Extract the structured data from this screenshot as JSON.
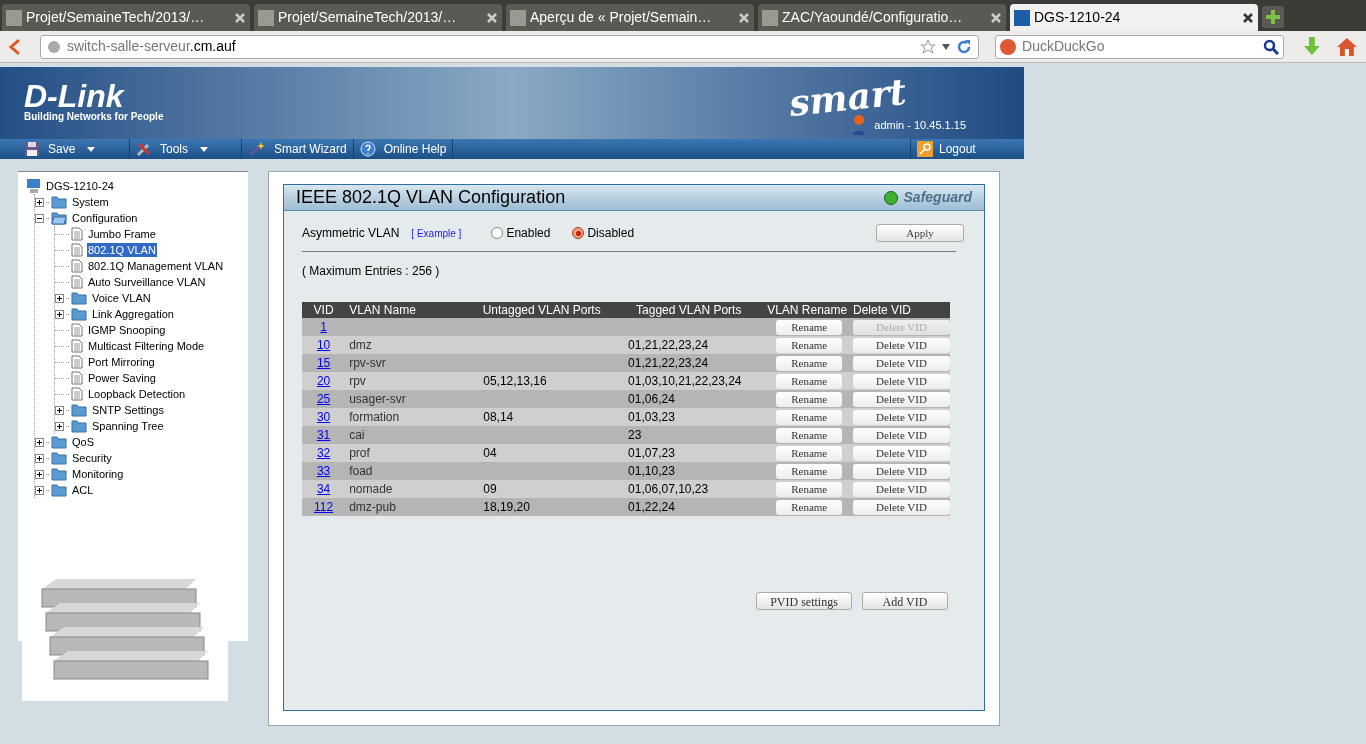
{
  "browser": {
    "tabs": [
      {
        "title": "Projet/SemaineTech/2013/…",
        "selected": false
      },
      {
        "title": "Projet/SemaineTech/2013/…",
        "selected": false
      },
      {
        "title": "Aperçu de « Projet/Semain…",
        "selected": false
      },
      {
        "title": "ZAC/Yaoundé/Configuratio…",
        "selected": false
      },
      {
        "title": "DGS-1210-24",
        "selected": true
      }
    ],
    "address": {
      "host": "switch-salle-serveur",
      "domain": ".cm.auf"
    },
    "search": {
      "placeholder": "DuckDuckGo"
    }
  },
  "header": {
    "brand": "D-Link",
    "tagline": "Building Networks for People",
    "product": "smart",
    "user": "admin - 10.45.1.15"
  },
  "menu": [
    {
      "label": "Save",
      "kind": "save",
      "dropdown": true
    },
    {
      "label": "Tools",
      "kind": "tools",
      "dropdown": true
    },
    {
      "label": "Smart Wizard",
      "kind": "wizard",
      "dropdown": false
    },
    {
      "label": "Online Help",
      "kind": "help",
      "dropdown": false
    }
  ],
  "logout": "Logout",
  "tree": {
    "root": "DGS-1210-24",
    "children": [
      {
        "label": "System",
        "kind": "folder",
        "expanded": false
      },
      {
        "label": "Configuration",
        "kind": "folder",
        "expanded": true,
        "children": [
          {
            "label": "Jumbo Frame",
            "kind": "page",
            "selected": false
          },
          {
            "label": "802.1Q VLAN",
            "kind": "page",
            "selected": true
          },
          {
            "label": "802.1Q Management VLAN",
            "kind": "page",
            "selected": false
          },
          {
            "label": "Auto Surveillance VLAN",
            "kind": "page",
            "selected": false
          },
          {
            "label": "Voice VLAN",
            "kind": "folder",
            "expanded": false
          },
          {
            "label": "Link Aggregation",
            "kind": "folder",
            "expanded": false
          },
          {
            "label": "IGMP Snooping",
            "kind": "page",
            "selected": false
          },
          {
            "label": "Multicast Filtering Mode",
            "kind": "page",
            "selected": false
          },
          {
            "label": "Port Mirroring",
            "kind": "page",
            "selected": false
          },
          {
            "label": "Power Saving",
            "kind": "page",
            "selected": false
          },
          {
            "label": "Loopback Detection",
            "kind": "page",
            "selected": false
          },
          {
            "label": "SNTP Settings",
            "kind": "folder",
            "expanded": false
          },
          {
            "label": "Spanning Tree",
            "kind": "folder",
            "expanded": false
          }
        ]
      },
      {
        "label": "QoS",
        "kind": "folder",
        "expanded": false
      },
      {
        "label": "Security",
        "kind": "folder",
        "expanded": false
      },
      {
        "label": "Monitoring",
        "kind": "folder",
        "expanded": false
      },
      {
        "label": "ACL",
        "kind": "folder",
        "expanded": false
      }
    ]
  },
  "panel": {
    "title": "IEEE 802.1Q VLAN Configuration",
    "safeguard": "Safeguard",
    "asymmetric": {
      "label": "Asymmetric VLAN",
      "example": "[ Example ]",
      "options": [
        {
          "label": "Enabled",
          "selected": false
        },
        {
          "label": "Disabled",
          "selected": true
        }
      ]
    },
    "apply": "Apply",
    "max_entries": "( Maximum Entries : 256 )",
    "columns": [
      "VID",
      "VLAN Name",
      "Untagged VLAN Ports",
      "Tagged VLAN Ports",
      "VLAN Rename",
      "Delete VID"
    ],
    "rows": [
      {
        "vid": "1",
        "name": "",
        "untagged": "",
        "tagged": "",
        "rename": "Rename",
        "delete": "Delete VID",
        "delete_disabled": true
      },
      {
        "vid": "10",
        "name": "dmz",
        "untagged": "",
        "tagged": "01,21,22,23,24",
        "rename": "Rename",
        "delete": "Delete VID",
        "delete_disabled": false
      },
      {
        "vid": "15",
        "name": "rpv-svr",
        "untagged": "",
        "tagged": "01,21,22,23,24",
        "rename": "Rename",
        "delete": "Delete VID",
        "delete_disabled": false
      },
      {
        "vid": "20",
        "name": "rpv",
        "untagged": "05,12,13,16",
        "tagged": "01,03,10,21,22,23,24",
        "rename": "Rename",
        "delete": "Delete VID",
        "delete_disabled": false
      },
      {
        "vid": "25",
        "name": "usager-svr",
        "untagged": "",
        "tagged": "01,06,24",
        "rename": "Rename",
        "delete": "Delete VID",
        "delete_disabled": false
      },
      {
        "vid": "30",
        "name": "formation",
        "untagged": "08,14",
        "tagged": "01,03,23",
        "rename": "Rename",
        "delete": "Delete VID",
        "delete_disabled": false
      },
      {
        "vid": "31",
        "name": "cai",
        "untagged": "",
        "tagged": "23",
        "rename": "Rename",
        "delete": "Delete VID",
        "delete_disabled": false
      },
      {
        "vid": "32",
        "name": "prof",
        "untagged": "04",
        "tagged": "01,07,23",
        "rename": "Rename",
        "delete": "Delete VID",
        "delete_disabled": false
      },
      {
        "vid": "33",
        "name": "foad",
        "untagged": "",
        "tagged": "01,10,23",
        "rename": "Rename",
        "delete": "Delete VID",
        "delete_disabled": false
      },
      {
        "vid": "34",
        "name": "nomade",
        "untagged": "09",
        "tagged": "01,06,07,10,23",
        "rename": "Rename",
        "delete": "Delete VID",
        "delete_disabled": false
      },
      {
        "vid": "112",
        "name": "dmz-pub",
        "untagged": "18,19,20",
        "tagged": "01,22,24",
        "rename": "Rename",
        "delete": "Delete VID",
        "delete_disabled": false
      }
    ],
    "buttons": [
      "PVID settings",
      "Add VID"
    ]
  }
}
